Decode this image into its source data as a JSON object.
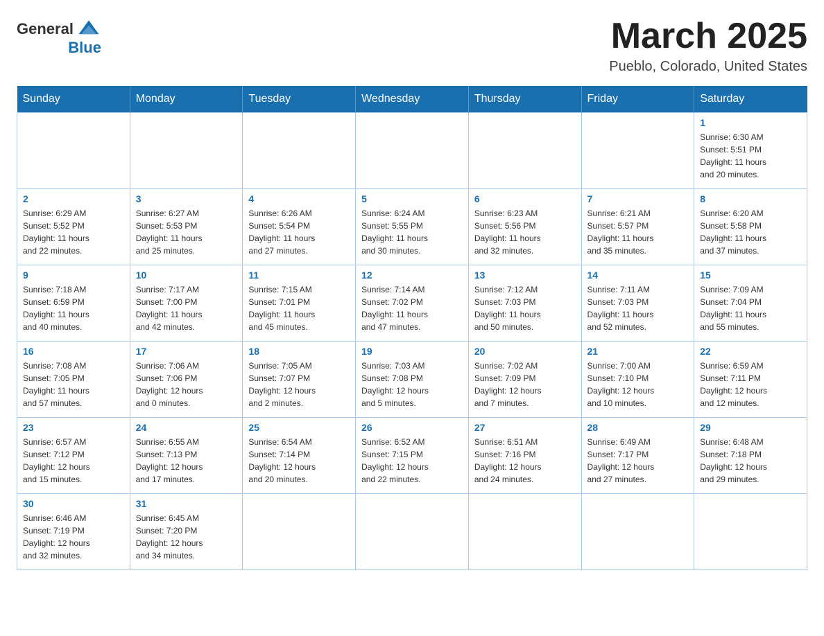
{
  "header": {
    "logo_text_general": "General",
    "logo_text_blue": "Blue",
    "month_title": "March 2025",
    "location": "Pueblo, Colorado, United States"
  },
  "weekdays": [
    "Sunday",
    "Monday",
    "Tuesday",
    "Wednesday",
    "Thursday",
    "Friday",
    "Saturday"
  ],
  "weeks": [
    [
      {
        "day": "",
        "info": ""
      },
      {
        "day": "",
        "info": ""
      },
      {
        "day": "",
        "info": ""
      },
      {
        "day": "",
        "info": ""
      },
      {
        "day": "",
        "info": ""
      },
      {
        "day": "",
        "info": ""
      },
      {
        "day": "1",
        "info": "Sunrise: 6:30 AM\nSunset: 5:51 PM\nDaylight: 11 hours\nand 20 minutes."
      }
    ],
    [
      {
        "day": "2",
        "info": "Sunrise: 6:29 AM\nSunset: 5:52 PM\nDaylight: 11 hours\nand 22 minutes."
      },
      {
        "day": "3",
        "info": "Sunrise: 6:27 AM\nSunset: 5:53 PM\nDaylight: 11 hours\nand 25 minutes."
      },
      {
        "day": "4",
        "info": "Sunrise: 6:26 AM\nSunset: 5:54 PM\nDaylight: 11 hours\nand 27 minutes."
      },
      {
        "day": "5",
        "info": "Sunrise: 6:24 AM\nSunset: 5:55 PM\nDaylight: 11 hours\nand 30 minutes."
      },
      {
        "day": "6",
        "info": "Sunrise: 6:23 AM\nSunset: 5:56 PM\nDaylight: 11 hours\nand 32 minutes."
      },
      {
        "day": "7",
        "info": "Sunrise: 6:21 AM\nSunset: 5:57 PM\nDaylight: 11 hours\nand 35 minutes."
      },
      {
        "day": "8",
        "info": "Sunrise: 6:20 AM\nSunset: 5:58 PM\nDaylight: 11 hours\nand 37 minutes."
      }
    ],
    [
      {
        "day": "9",
        "info": "Sunrise: 7:18 AM\nSunset: 6:59 PM\nDaylight: 11 hours\nand 40 minutes."
      },
      {
        "day": "10",
        "info": "Sunrise: 7:17 AM\nSunset: 7:00 PM\nDaylight: 11 hours\nand 42 minutes."
      },
      {
        "day": "11",
        "info": "Sunrise: 7:15 AM\nSunset: 7:01 PM\nDaylight: 11 hours\nand 45 minutes."
      },
      {
        "day": "12",
        "info": "Sunrise: 7:14 AM\nSunset: 7:02 PM\nDaylight: 11 hours\nand 47 minutes."
      },
      {
        "day": "13",
        "info": "Sunrise: 7:12 AM\nSunset: 7:03 PM\nDaylight: 11 hours\nand 50 minutes."
      },
      {
        "day": "14",
        "info": "Sunrise: 7:11 AM\nSunset: 7:03 PM\nDaylight: 11 hours\nand 52 minutes."
      },
      {
        "day": "15",
        "info": "Sunrise: 7:09 AM\nSunset: 7:04 PM\nDaylight: 11 hours\nand 55 minutes."
      }
    ],
    [
      {
        "day": "16",
        "info": "Sunrise: 7:08 AM\nSunset: 7:05 PM\nDaylight: 11 hours\nand 57 minutes."
      },
      {
        "day": "17",
        "info": "Sunrise: 7:06 AM\nSunset: 7:06 PM\nDaylight: 12 hours\nand 0 minutes."
      },
      {
        "day": "18",
        "info": "Sunrise: 7:05 AM\nSunset: 7:07 PM\nDaylight: 12 hours\nand 2 minutes."
      },
      {
        "day": "19",
        "info": "Sunrise: 7:03 AM\nSunset: 7:08 PM\nDaylight: 12 hours\nand 5 minutes."
      },
      {
        "day": "20",
        "info": "Sunrise: 7:02 AM\nSunset: 7:09 PM\nDaylight: 12 hours\nand 7 minutes."
      },
      {
        "day": "21",
        "info": "Sunrise: 7:00 AM\nSunset: 7:10 PM\nDaylight: 12 hours\nand 10 minutes."
      },
      {
        "day": "22",
        "info": "Sunrise: 6:59 AM\nSunset: 7:11 PM\nDaylight: 12 hours\nand 12 minutes."
      }
    ],
    [
      {
        "day": "23",
        "info": "Sunrise: 6:57 AM\nSunset: 7:12 PM\nDaylight: 12 hours\nand 15 minutes."
      },
      {
        "day": "24",
        "info": "Sunrise: 6:55 AM\nSunset: 7:13 PM\nDaylight: 12 hours\nand 17 minutes."
      },
      {
        "day": "25",
        "info": "Sunrise: 6:54 AM\nSunset: 7:14 PM\nDaylight: 12 hours\nand 20 minutes."
      },
      {
        "day": "26",
        "info": "Sunrise: 6:52 AM\nSunset: 7:15 PM\nDaylight: 12 hours\nand 22 minutes."
      },
      {
        "day": "27",
        "info": "Sunrise: 6:51 AM\nSunset: 7:16 PM\nDaylight: 12 hours\nand 24 minutes."
      },
      {
        "day": "28",
        "info": "Sunrise: 6:49 AM\nSunset: 7:17 PM\nDaylight: 12 hours\nand 27 minutes."
      },
      {
        "day": "29",
        "info": "Sunrise: 6:48 AM\nSunset: 7:18 PM\nDaylight: 12 hours\nand 29 minutes."
      }
    ],
    [
      {
        "day": "30",
        "info": "Sunrise: 6:46 AM\nSunset: 7:19 PM\nDaylight: 12 hours\nand 32 minutes."
      },
      {
        "day": "31",
        "info": "Sunrise: 6:45 AM\nSunset: 7:20 PM\nDaylight: 12 hours\nand 34 minutes."
      },
      {
        "day": "",
        "info": ""
      },
      {
        "day": "",
        "info": ""
      },
      {
        "day": "",
        "info": ""
      },
      {
        "day": "",
        "info": ""
      },
      {
        "day": "",
        "info": ""
      }
    ]
  ]
}
